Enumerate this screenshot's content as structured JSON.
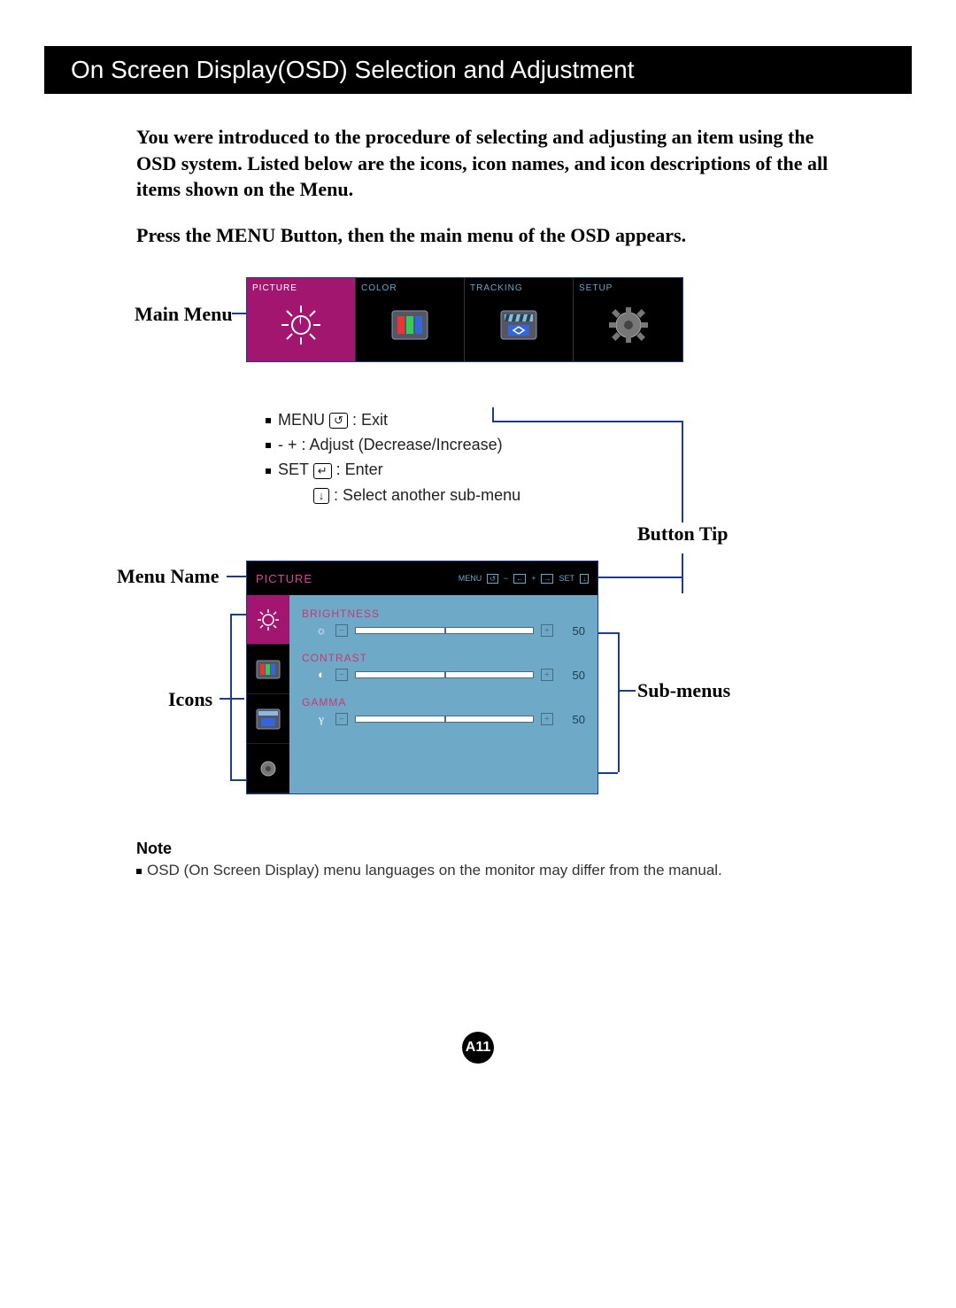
{
  "header": {
    "title": "On Screen Display(OSD) Selection and Adjustment"
  },
  "intro": {
    "p1": "You were introduced to the procedure of selecting and adjusting an item using the OSD system.  Listed below are the icons, icon names, and icon descriptions of the all items shown on the Menu.",
    "p2": "Press the MENU Button, then the main menu of the OSD appears."
  },
  "labels": {
    "main_menu": "Main Menu",
    "menu_name": "Menu Name",
    "icons": "Icons",
    "button_tip": "Button Tip",
    "sub_menus": "Sub-menus"
  },
  "main_menu": {
    "tiles": [
      {
        "label": "PICTURE",
        "active": true
      },
      {
        "label": "COLOR",
        "active": false
      },
      {
        "label": "TRACKING",
        "active": false
      },
      {
        "label": "SETUP",
        "active": false
      }
    ]
  },
  "instructions": {
    "rows": [
      {
        "prefix": "MENU",
        "key": "↺",
        "desc": ": Exit"
      },
      {
        "prefix": "- +",
        "key": "",
        "desc": ": Adjust (Decrease/Increase)"
      },
      {
        "prefix": "SET",
        "key": "↵",
        "desc": ": Enter"
      },
      {
        "prefix": "",
        "key": "↓",
        "desc": ": Select another sub-menu"
      }
    ]
  },
  "sub_panel": {
    "title": "PICTURE",
    "tips": {
      "menu": "MENU",
      "minus": "−",
      "plus": "+",
      "set": "SET"
    },
    "items": [
      {
        "label": "BRIGHTNESS",
        "symbol": "☼",
        "value": "50"
      },
      {
        "label": "CONTRAST",
        "symbol": "◐",
        "value": "50"
      },
      {
        "label": "GAMMA",
        "symbol": "γ",
        "value": "50"
      }
    ]
  },
  "note": {
    "title": "Note",
    "body": "OSD (On Screen Display) menu languages on the monitor may differ from the manual."
  },
  "page_number": "A11"
}
